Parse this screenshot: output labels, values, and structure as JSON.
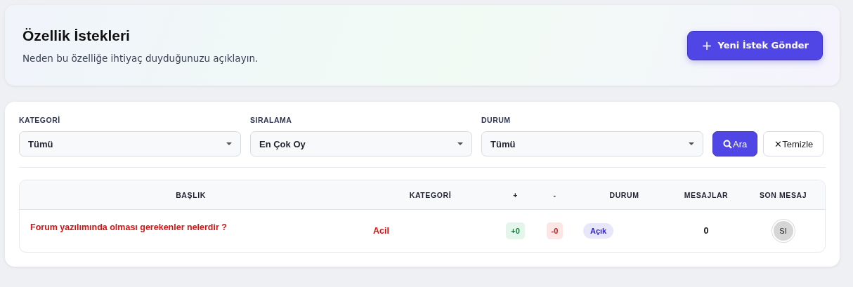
{
  "header": {
    "title": "Özellik İstekleri",
    "subtitle": "Neden bu özelliğe ihtiyaç duyduğunuzu açıklayın.",
    "new_button": {
      "icon": "+",
      "label": "Yeni İstek Gönder"
    }
  },
  "filters": [
    {
      "label": "KATEGORİ",
      "value": "Tümü"
    },
    {
      "label": "SIRALAMA",
      "value": "En Çok Oy"
    },
    {
      "label": "DURUM",
      "value": "Tümü"
    }
  ],
  "search_button": {
    "label": "Ara"
  },
  "clear_button": {
    "icon": "✕",
    "label": "Temizle"
  },
  "table": {
    "columns": [
      "BAŞLIK",
      "KATEGORİ",
      "+",
      "-",
      "DURUM",
      "MESAJLAR",
      "SON MESAJ"
    ],
    "rows": [
      {
        "title": "Forum yazılımında olması gerekenler nelerdir ?",
        "category": "Acil",
        "upvotes": "+0",
        "downvotes": "-0",
        "status": "Açık",
        "messages": "0",
        "last_message": "SI"
      }
    ]
  }
}
